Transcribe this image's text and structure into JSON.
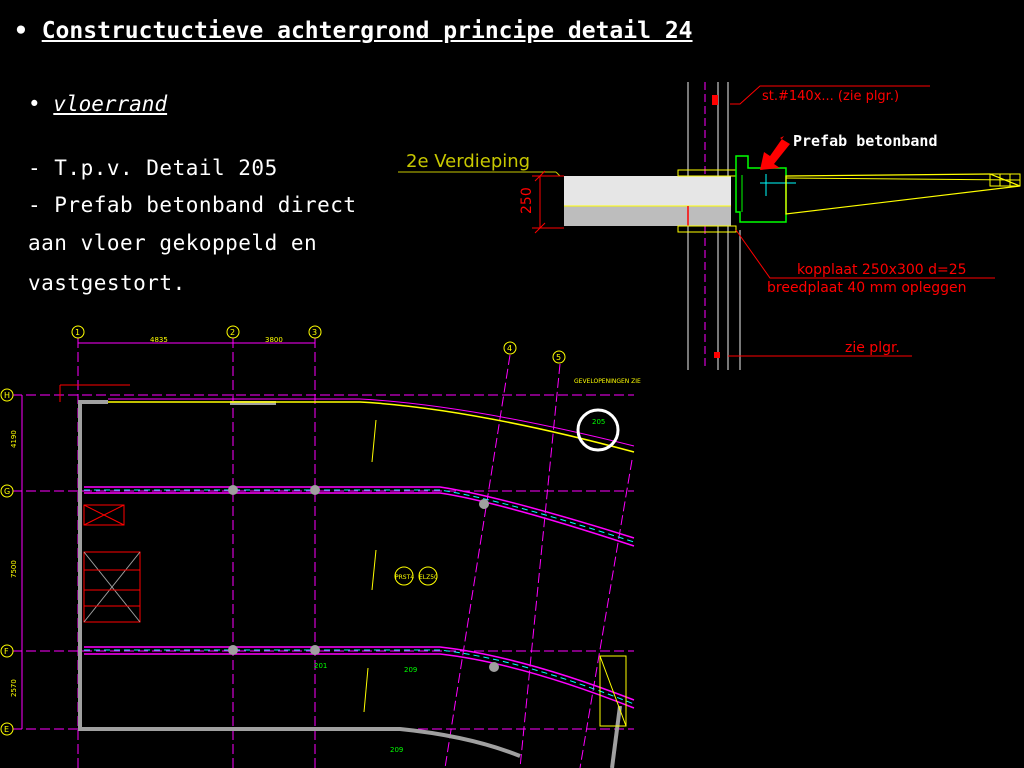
{
  "slide": {
    "title": "Constructuctieve achtergrond principe detail 24",
    "subtitle": "vloerrand",
    "lines": [
      "- T.p.v. Detail 205",
      "- Prefab betonband direct",
      "  aan vloer gekoppeld en",
      "  vastgestort."
    ]
  },
  "detail": {
    "floor_label": "2e Verdieping",
    "dim_250": "250",
    "note_top": "st.#140x... (zie plgr.)",
    "callout": "Prefab betonband",
    "note_koppel1": "kopplaat 250x300 d=25",
    "note_koppel2": "breedplaat 40 mm opleggen",
    "note_bottom": "zie plgr."
  },
  "plan": {
    "grid_top": [
      "1",
      "2",
      "3",
      "4",
      "5"
    ],
    "grid_left": [
      "H",
      "G",
      "F",
      "E"
    ],
    "dim_top": [
      "4835",
      "3800"
    ],
    "dim_left": [
      "4190",
      "7500",
      "2570"
    ],
    "detail_ref": "205",
    "col_markers": [
      "209",
      "201",
      "209"
    ],
    "centre_tag1": "PRST4",
    "centre_tag2": "ELZ50",
    "top_note": "GEVELOPENINGEN ZIE"
  },
  "colors": {
    "magenta": "#ff00ff",
    "yellow": "#ffff00",
    "green": "#00ff00",
    "red": "#ff0000",
    "grey": "#a0a0a0",
    "white": "#ffffff"
  }
}
